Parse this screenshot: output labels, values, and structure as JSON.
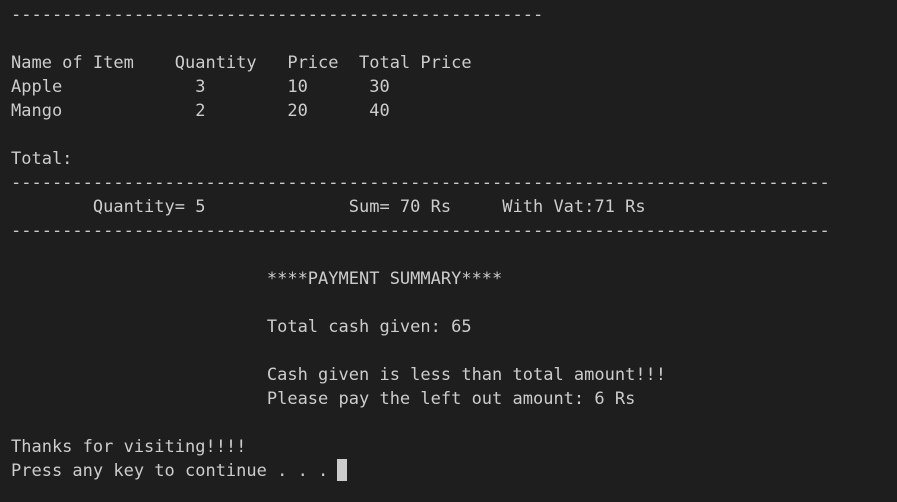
{
  "console": {
    "lines": {
      "divider_short": "----------------------------------------------------",
      "header": "Name of Item    Quantity   Price  Total Price",
      "row_1": "Apple             3        10      30",
      "row_2": "Mango             2        20      40",
      "total_label": "Total:",
      "divider_long_top": "--------------------------------------------------------------------------------",
      "summary_line": "        Quantity= 5              Sum= 70 Rs     With Vat:71 Rs",
      "divider_long_bottom": "--------------------------------------------------------------------------------",
      "payment_title": "                         ****PAYMENT SUMMARY****",
      "cash_given": "                         Total cash given: 65",
      "warning": "                         Cash given is less than total amount!!!",
      "left_amount": "                         Please pay the left out amount: 6 Rs",
      "thanks": "Thanks for visiting!!!!",
      "prompt": "Press any key to continue . . ."
    }
  }
}
